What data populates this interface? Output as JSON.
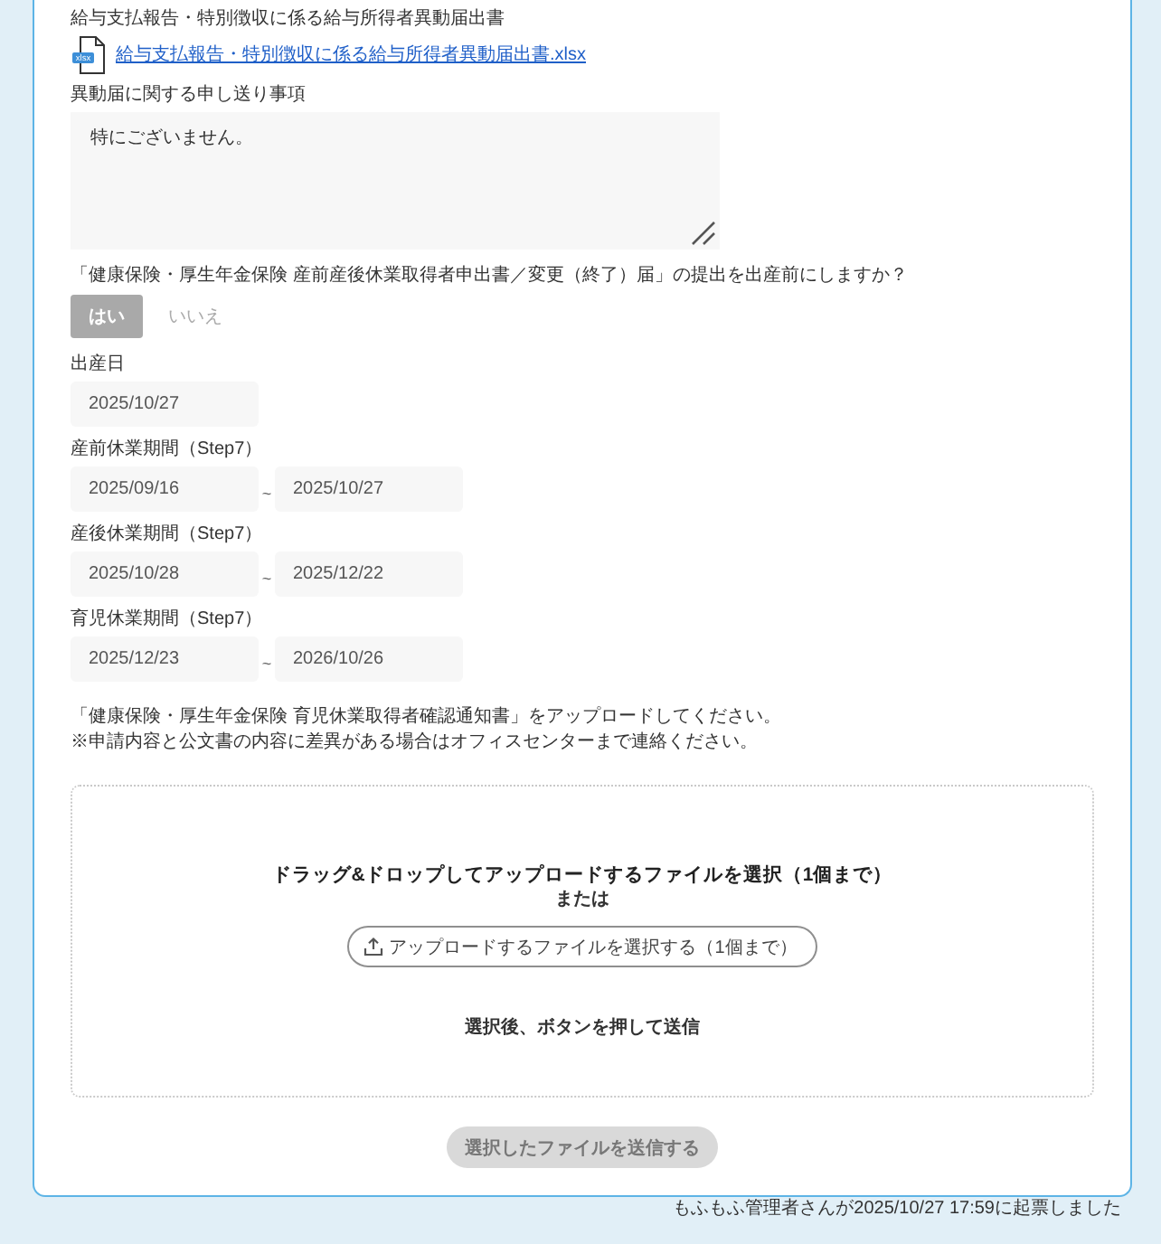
{
  "attachment": {
    "label": "給与支払報告・特別徴収に係る給与所得者異動届出書",
    "file": {
      "file_type": "xlsx",
      "name": "給与支払報告・特別徴収に係る給与所得者異動届出書.xlsx"
    }
  },
  "handover_notes": {
    "label": "異動届に関する申し送り事項",
    "value": "特にございません。"
  },
  "advance_submission": {
    "question": "「健康保険・厚生年金保険 産前産後休業取得者申出書／変更（終了）届」の提出を出産前にしますか？",
    "options": [
      {
        "label": "はい",
        "selected": true
      },
      {
        "label": "いいえ",
        "selected": false
      }
    ]
  },
  "birth_date": {
    "label": "出産日",
    "value": "2025/10/27"
  },
  "periods": [
    {
      "label": "産前休業期間（Step7）",
      "start": "2025/09/16",
      "separator": "~",
      "end": "2025/10/27"
    },
    {
      "label": "産後休業期間（Step7）",
      "start": "2025/10/28",
      "separator": "~",
      "end": "2025/12/22"
    },
    {
      "label": "育児休業期間（Step7）",
      "start": "2025/12/23",
      "separator": "~",
      "end": "2026/10/26"
    }
  ],
  "upload": {
    "instructions": [
      "「健康保険・厚生年金保険 育児休業取得者確認通知書」をアップロードしてください。",
      "※申請内容と公文書の内容に差異がある場合はオフィスセンターまで連絡ください。"
    ],
    "dropzone": {
      "title": "ドラッグ&ドロップしてアップロードするファイルを選択（1個まで）",
      "or": "または",
      "button": "アップロードするファイルを選択する（1個まで）",
      "hint": "選択後、ボタンを押して送信"
    },
    "submit": {
      "label": "選択したファイルを送信する",
      "disabled": true
    }
  },
  "footer": "もふもふ管理者さんが2025/10/27 17:59に起票しました"
}
